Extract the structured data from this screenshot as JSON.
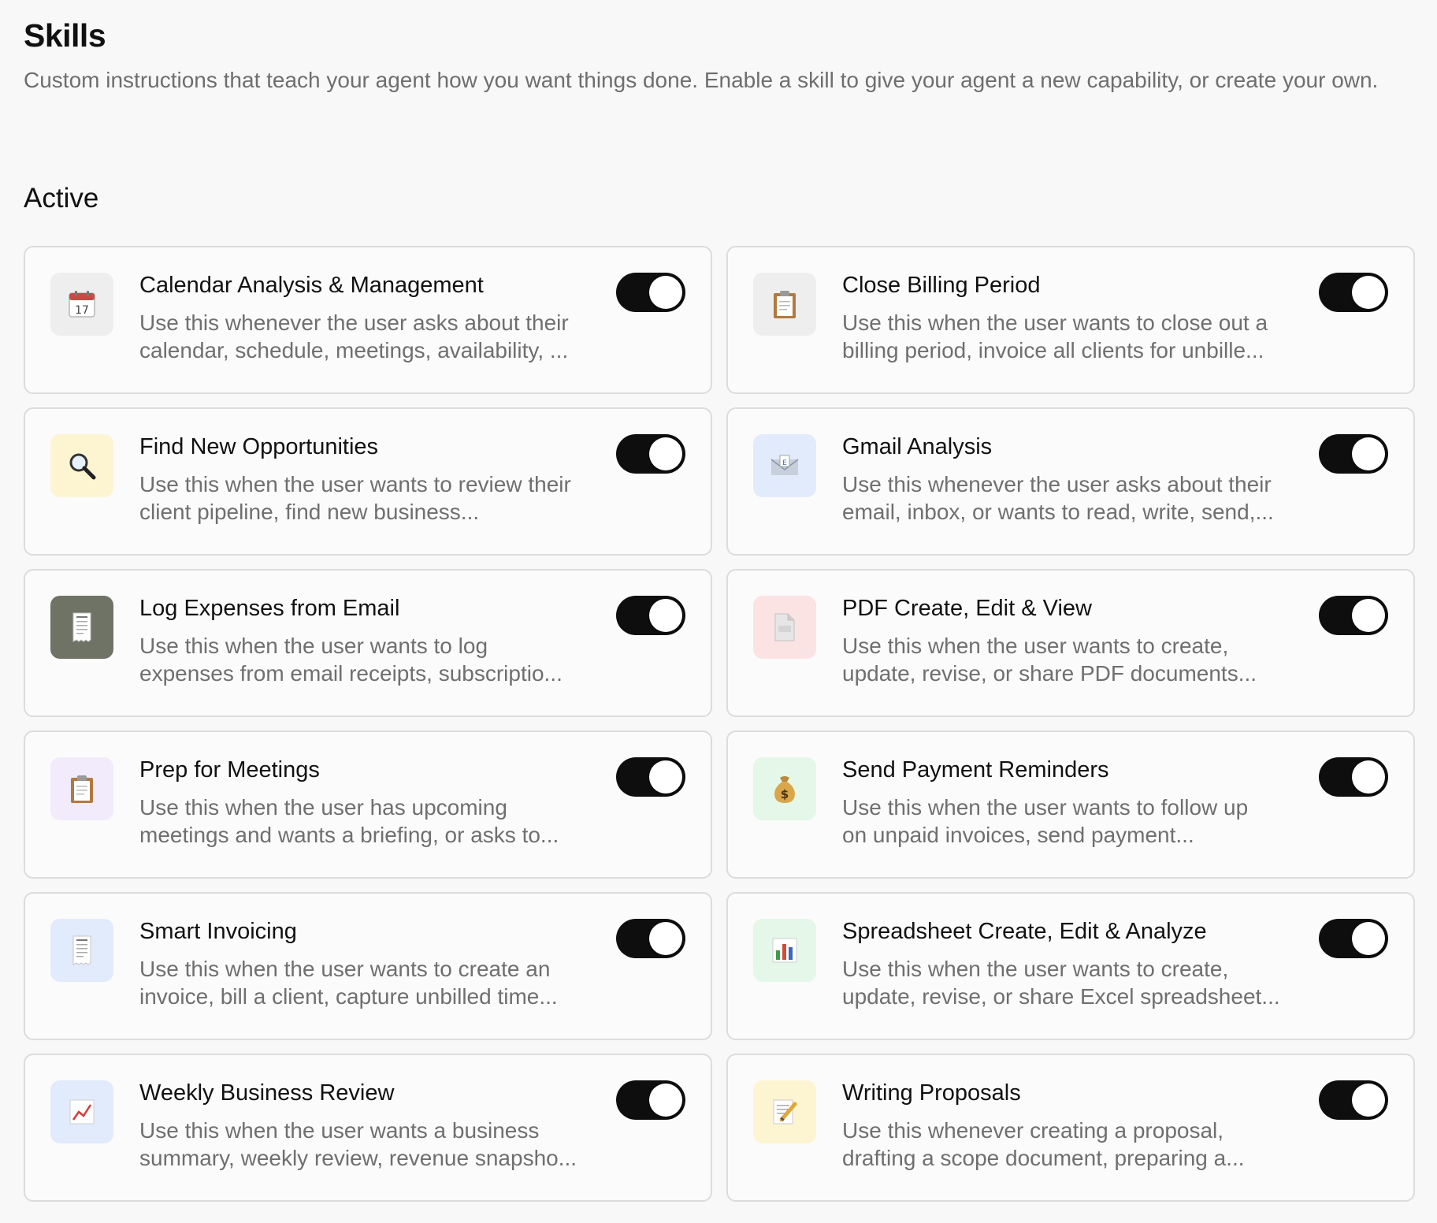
{
  "page": {
    "title": "Skills",
    "subtitle": "Custom instructions that teach your agent how you want things done. Enable a skill to give your agent a new capability, or create your own."
  },
  "active_section": {
    "title": "Active",
    "skills": [
      {
        "title": "Calendar Analysis & Management",
        "description": "Use this whenever the user asks about their\ncalendar, schedule, meetings, availability, ...",
        "icon": "calendar-icon",
        "tile_color": "#eeeeef",
        "enabled": true
      },
      {
        "title": "Close Billing Period",
        "description": "Use this when the user wants to close out a\nbilling period, invoice all clients for unbille...",
        "icon": "clipboard-icon",
        "tile_color": "#eeeeef",
        "enabled": true
      },
      {
        "title": "Find New Opportunities",
        "description": "Use this when the user wants to review their\nclient pipeline, find new business...",
        "icon": "magnifier-icon",
        "tile_color": "#fdf5d2",
        "enabled": true
      },
      {
        "title": "Gmail Analysis",
        "description": "Use this whenever the user asks about their\nemail, inbox, or wants to read, write, send,...",
        "icon": "envelope-icon",
        "tile_color": "#e2ebfb",
        "enabled": true
      },
      {
        "title": "Log Expenses from Email",
        "description": "Use this when the user wants to log\nexpenses from email receipts, subscriptio...",
        "icon": "receipt-icon",
        "tile_color": "#6f7365",
        "enabled": true
      },
      {
        "title": "PDF Create, Edit & View",
        "description": "Use this when the user wants to create,\nupdate, revise, or share PDF documents...",
        "icon": "document-icon",
        "tile_color": "#fbe3e3",
        "enabled": true
      },
      {
        "title": "Prep for Meetings",
        "description": "Use this when the user has upcoming\nmeetings and wants a briefing, or asks to...",
        "icon": "clipboard-icon",
        "tile_color": "#f1ebfb",
        "enabled": true
      },
      {
        "title": "Send Payment Reminders",
        "description": "Use this when the user wants to follow up\non unpaid invoices, send payment...",
        "icon": "money-bag-icon",
        "tile_color": "#e4f7e8",
        "enabled": true
      },
      {
        "title": "Smart Invoicing",
        "description": "Use this when the user wants to create an\ninvoice, bill a client, capture unbilled time...",
        "icon": "receipt-icon",
        "tile_color": "#e2ebfb",
        "enabled": true
      },
      {
        "title": "Spreadsheet Create, Edit & Analyze",
        "description": "Use this when the user wants to create,\nupdate, revise, or share Excel spreadsheet...",
        "icon": "bar-chart-icon",
        "tile_color": "#e4f7e8",
        "enabled": true
      },
      {
        "title": "Weekly Business Review",
        "description": "Use this when the user wants a business\nsummary, weekly review, revenue snapsho...",
        "icon": "trend-chart-icon",
        "tile_color": "#e2ebfb",
        "enabled": true
      },
      {
        "title": "Writing Proposals",
        "description": "Use this whenever creating a proposal,\ndrafting a scope document, preparing a...",
        "icon": "memo-icon",
        "tile_color": "#fdf5d2",
        "enabled": true
      }
    ]
  }
}
